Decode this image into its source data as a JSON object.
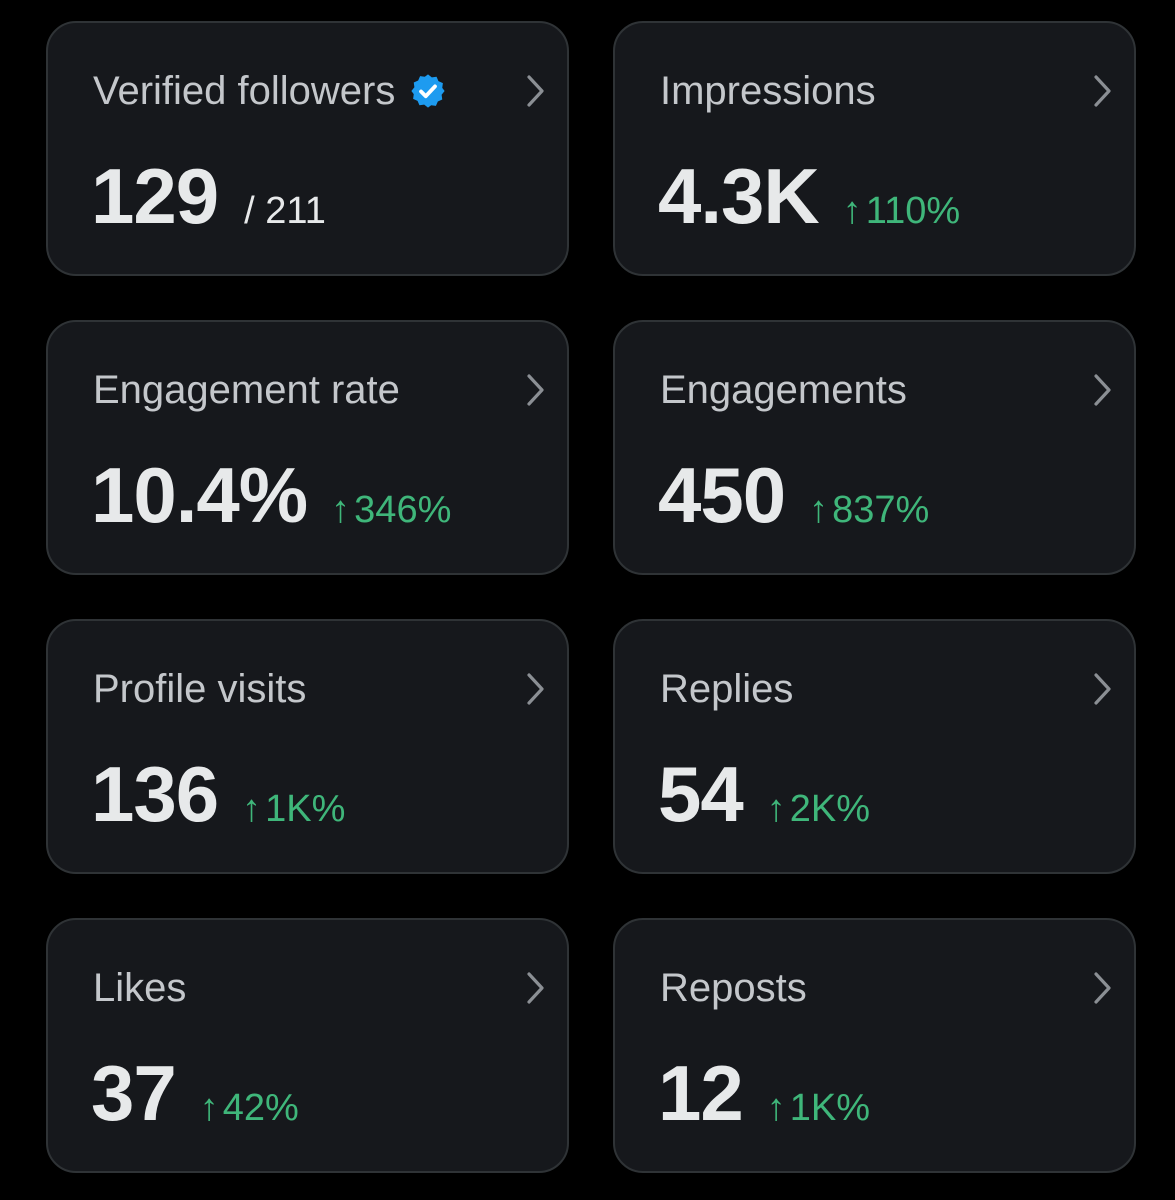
{
  "colors": {
    "background": "#000000",
    "card": "#16181c",
    "card_border": "#2f3336",
    "title": "#c4c7cb",
    "value": "#e7e9ea",
    "positive": "#3fb67a",
    "verified": "#1d9bf0"
  },
  "cards": [
    {
      "title": "Verified followers",
      "value": "129",
      "total": "/ 211",
      "icon": "verified-badge-icon"
    },
    {
      "title": "Impressions",
      "value": "4.3K",
      "arrow": "↑",
      "change": "110%"
    },
    {
      "title": "Engagement rate",
      "value": "10.4%",
      "arrow": "↑",
      "change": "346%"
    },
    {
      "title": "Engagements",
      "value": "450",
      "arrow": "↑",
      "change": "837%"
    },
    {
      "title": "Profile visits",
      "value": "136",
      "arrow": "↑",
      "change": "1K%"
    },
    {
      "title": "Replies",
      "value": "54",
      "arrow": "↑",
      "change": "2K%"
    },
    {
      "title": "Likes",
      "value": "37",
      "arrow": "↑",
      "change": "42%"
    },
    {
      "title": "Reposts",
      "value": "12",
      "arrow": "↑",
      "change": "1K%"
    }
  ]
}
